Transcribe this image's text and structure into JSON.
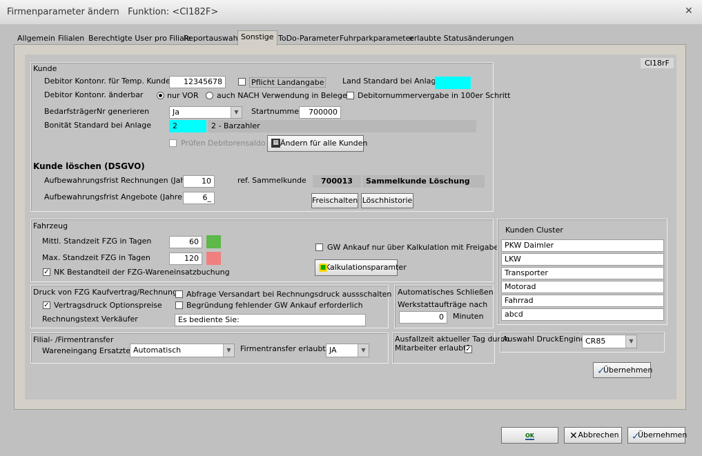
{
  "window": {
    "title": "Firmenparameter ändern   Funktion: <CI182F>"
  },
  "tabs": [
    "Allgemein",
    "Filialen",
    "Berechtigte User pro Filiale",
    "Reportauswahl",
    "Sonstige",
    "ToDo-Parameter",
    "Fuhrparkparameter",
    "erlaubte Statusänderungen"
  ],
  "form_id": "CI18rF",
  "kunde": {
    "group": "Kunde",
    "debitor_temp_label": "Debitor Kontonr. für Temp. Kunden",
    "debitor_temp_value": "12345678",
    "pflicht_land": "Pflicht Landangabe",
    "land_standard": "Land Standard bei Anlage",
    "debitor_aenderbar": "Debitor Kontonr. änderbar",
    "nur_vor": "nur VOR",
    "auch_nach": "auch NACH Verwendung in Belegen",
    "debitor_100er": "Debitornummervergabe in 100er Schritt",
    "bedarf_label": "BedarfsträgerNr generieren",
    "bedarf_value": "Ja",
    "startnummer_label": "Startnummer",
    "startnummer_value": "700000",
    "bonitaet_label": "Bonität Standard bei Anlage",
    "bonitaet_code": "2",
    "bonitaet_text": "2 - Barzahler",
    "pruefen": "Prüfen Debitorensaldo",
    "aendern_btn": "Ändern für alle Kunden"
  },
  "loeschen": {
    "title": "Kunde löschen (DSGVO)",
    "rechnungen_label": "Aufbewahrungsfrist Rechnungen (Jahre)",
    "rechnungen_value": "10",
    "sammel_label": "ref. Sammelkunde",
    "sammel_nr": "700013",
    "sammel_name": "Sammelkunde Löschung",
    "angebote_label": "Aufbewahrungsfrist Angebote (Jahre)",
    "angebote_value": "6_",
    "freischalten": "Freischalten",
    "historie": "Löschhistorie"
  },
  "fahrzeug": {
    "group": "Fahrzeug",
    "mittl_label": "Mittl. Standzeit FZG in Tagen",
    "mittl_value": "60",
    "max_label": "Max. Standzeit FZG in Tagen",
    "max_value": "120",
    "nk_label": "NK Bestandteil der FZG-Wareneinsatzbuchung",
    "gw_label": "GW Ankauf nur über Kalkulation mit Freigabe",
    "kalk_btn": "Kalkulationsparamter",
    "green": "#5cb848",
    "red": "#f08080"
  },
  "cluster": {
    "group": "Kunden Cluster",
    "items": [
      "PKW Daimler",
      "LKW",
      "Transporter",
      "Motorad",
      "Fahrrad",
      "abcd"
    ]
  },
  "druck": {
    "group": "Druck von FZG Kaufvertrag/Rechnung",
    "vertrag": "Vertragsdruck Optionspreise",
    "abfrage": "Abfrage Versandart bei Rechnungsdruck aussschalten",
    "begruendung": "Begründung fehlender GW Ankauf erforderlich",
    "rechnungstext_label": "Rechnungstext Verkäufer",
    "rechnungstext_value": "Es bediente Sie:"
  },
  "auto": {
    "group": "Automatisches Schließen",
    "label": "Werkstattaufträge nach",
    "value": "0",
    "unit": "Minuten"
  },
  "filial": {
    "group": "Filial- /Firmentransfer",
    "wareneingang_label": "Wareneingang Ersatzteile",
    "wareneingang_value": "Automatisch",
    "transfer_label": "Firmentransfer erlaubt",
    "transfer_value": "JA"
  },
  "ausfall": {
    "line1": "Ausfallzeit aktueller Tag durch",
    "line2": "Mitarbeiter erlaubt?"
  },
  "engine": {
    "label": "Auswahl DruckEngine",
    "value": "CR85"
  },
  "buttons": {
    "uebernehmen": "Übernehmen",
    "ok": "OK",
    "abbrechen": "Abbrechen"
  }
}
